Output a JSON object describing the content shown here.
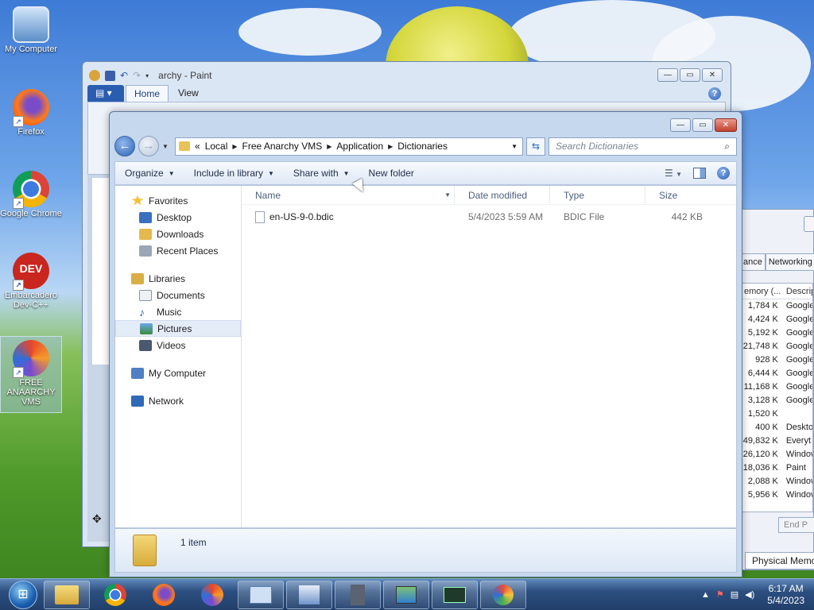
{
  "desktop": {
    "icons": [
      {
        "label": "My Computer"
      },
      {
        "label": "Firefox"
      },
      {
        "label": "Google Chrome"
      },
      {
        "label": "Embarcadero Dev-C++"
      },
      {
        "label": "FREE ANAARCHY VMS"
      }
    ]
  },
  "paint": {
    "title": "archy - Paint",
    "tabs": [
      "Home",
      "View"
    ]
  },
  "taskmanager": {
    "tabs": [
      "ance",
      "Networking"
    ],
    "headers": [
      "emory (...",
      "Descrip"
    ],
    "rows": [
      {
        "mem": "1,784 K",
        "desc": "Google"
      },
      {
        "mem": "4,424 K",
        "desc": "Google"
      },
      {
        "mem": "5,192 K",
        "desc": "Google"
      },
      {
        "mem": "21,748 K",
        "desc": "Google"
      },
      {
        "mem": "928 K",
        "desc": "Google"
      },
      {
        "mem": "6,444 K",
        "desc": "Google"
      },
      {
        "mem": "11,168 K",
        "desc": "Google"
      },
      {
        "mem": "3,128 K",
        "desc": "Google"
      },
      {
        "mem": "1,520 K",
        "desc": ""
      },
      {
        "mem": "400 K",
        "desc": "Deskto"
      },
      {
        "mem": "49,832 K",
        "desc": "Everyt"
      },
      {
        "mem": "26,120 K",
        "desc": "Window"
      },
      {
        "mem": "18,036 K",
        "desc": "Paint"
      },
      {
        "mem": "2,088 K",
        "desc": "Window"
      },
      {
        "mem": "5,956 K",
        "desc": "Window"
      }
    ],
    "end_button": "End P",
    "physical_memory": "Physical Memo"
  },
  "explorer": {
    "breadcrumb": [
      "«",
      "Local",
      "Free Anarchy VMS",
      "Application",
      "Dictionaries"
    ],
    "search_placeholder": "Search Dictionaries",
    "toolbar": {
      "organize": "Organize",
      "include_in_library": "Include in library",
      "share_with": "Share with",
      "new_folder": "New folder"
    },
    "nav": {
      "favorites": "Favorites",
      "desktop": "Desktop",
      "downloads": "Downloads",
      "recent_places": "Recent Places",
      "libraries": "Libraries",
      "documents": "Documents",
      "music": "Music",
      "pictures": "Pictures",
      "videos": "Videos",
      "my_computer": "My Computer",
      "network": "Network"
    },
    "columns": {
      "name": "Name",
      "date": "Date modified",
      "type": "Type",
      "size": "Size"
    },
    "files": [
      {
        "name": "en-US-9-0.bdic",
        "date": "5/4/2023 5:59 AM",
        "type": "BDIC File",
        "size": "442 KB"
      }
    ],
    "item_count": "1 item"
  },
  "taskbar": {
    "time": "6:17 AM",
    "date": "5/4/2023"
  }
}
